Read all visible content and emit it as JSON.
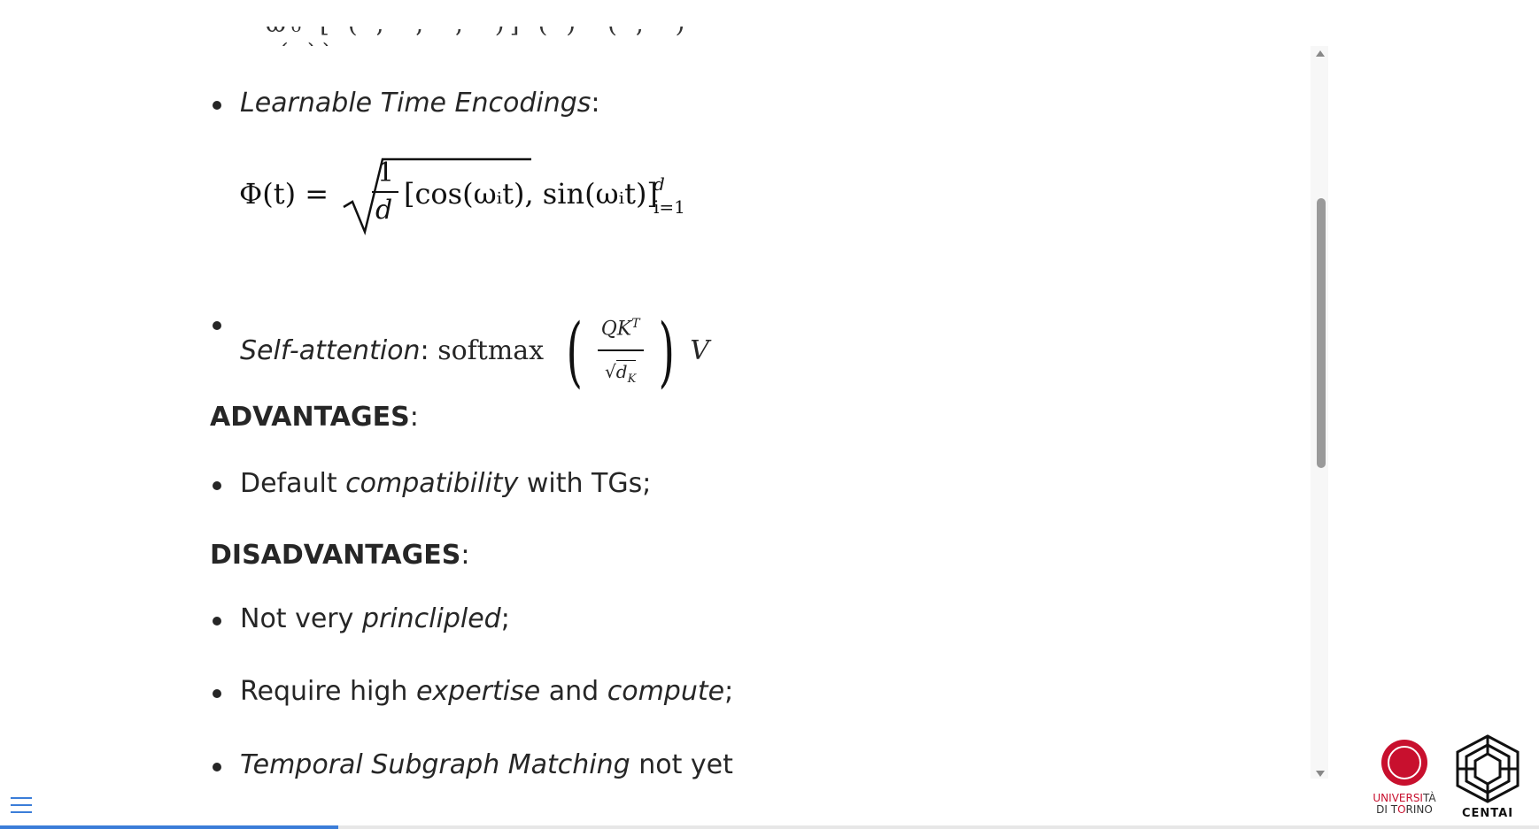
{
  "slide": {
    "top_clipped_formula": "ω₀ [   (·, ·, ·, ·)] (·)      ·(·, ·)   ·(·))",
    "bullets": {
      "learnable": {
        "label": "Learnable Time Encodings",
        "punct": ":"
      },
      "self_attention": {
        "label": "Self-attention",
        "punct": ":",
        "softmax": "softmax",
        "numerator": "QK",
        "numerator_sup": "T",
        "denominator": "d",
        "denominator_sub": "K",
        "tail": "V"
      }
    },
    "equation": {
      "lhs": "Φ(t) =",
      "num": "1",
      "den": "d",
      "rhs": "[cos(ωᵢt), sin(ωᵢt)]",
      "sup": "d",
      "sub": "i=1"
    },
    "advantages": {
      "heading": "ADVANTAGES",
      "punct": ":",
      "items": [
        {
          "pre": "Default ",
          "em": "compatibility",
          "post": " with TGs;"
        }
      ]
    },
    "disadvantages": {
      "heading": "DISADVANTAGES",
      "punct": ":",
      "items": [
        {
          "pre": "Not very ",
          "em": "princlipled",
          "post": ";"
        },
        {
          "pre": "Require high ",
          "em": "expertise",
          "mid": " and ",
          "em2": "compute",
          "post": ";"
        },
        {
          "pre": "",
          "em": "Temporal Subgraph Matching",
          "post": " not yet"
        }
      ]
    }
  },
  "progress": {
    "fraction": 0.22
  },
  "logos": {
    "unito_line1_red": "UNIVERSI",
    "unito_line1_rest": "TÀ",
    "unito_line2_a": "DI T",
    "unito_line2_red": "O",
    "unito_line2_b": "RINO",
    "centai": "CENTAI"
  },
  "icons": {
    "menu": "hamburger-menu-icon",
    "scroll_up": "triangle-up-icon",
    "scroll_down": "triangle-down-icon"
  },
  "colors": {
    "accent": "#3b7dd8",
    "unito_red": "#c8102e"
  }
}
